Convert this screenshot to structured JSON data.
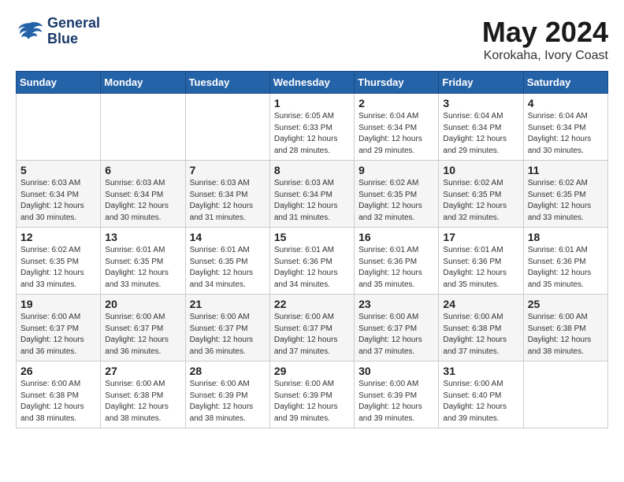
{
  "logo": {
    "line1": "General",
    "line2": "Blue"
  },
  "title": "May 2024",
  "location": "Korokaha, Ivory Coast",
  "weekdays": [
    "Sunday",
    "Monday",
    "Tuesday",
    "Wednesday",
    "Thursday",
    "Friday",
    "Saturday"
  ],
  "weeks": [
    [
      {
        "day": "",
        "info": ""
      },
      {
        "day": "",
        "info": ""
      },
      {
        "day": "",
        "info": ""
      },
      {
        "day": "1",
        "info": "Sunrise: 6:05 AM\nSunset: 6:33 PM\nDaylight: 12 hours\nand 28 minutes."
      },
      {
        "day": "2",
        "info": "Sunrise: 6:04 AM\nSunset: 6:34 PM\nDaylight: 12 hours\nand 29 minutes."
      },
      {
        "day": "3",
        "info": "Sunrise: 6:04 AM\nSunset: 6:34 PM\nDaylight: 12 hours\nand 29 minutes."
      },
      {
        "day": "4",
        "info": "Sunrise: 6:04 AM\nSunset: 6:34 PM\nDaylight: 12 hours\nand 30 minutes."
      }
    ],
    [
      {
        "day": "5",
        "info": "Sunrise: 6:03 AM\nSunset: 6:34 PM\nDaylight: 12 hours\nand 30 minutes."
      },
      {
        "day": "6",
        "info": "Sunrise: 6:03 AM\nSunset: 6:34 PM\nDaylight: 12 hours\nand 30 minutes."
      },
      {
        "day": "7",
        "info": "Sunrise: 6:03 AM\nSunset: 6:34 PM\nDaylight: 12 hours\nand 31 minutes."
      },
      {
        "day": "8",
        "info": "Sunrise: 6:03 AM\nSunset: 6:34 PM\nDaylight: 12 hours\nand 31 minutes."
      },
      {
        "day": "9",
        "info": "Sunrise: 6:02 AM\nSunset: 6:35 PM\nDaylight: 12 hours\nand 32 minutes."
      },
      {
        "day": "10",
        "info": "Sunrise: 6:02 AM\nSunset: 6:35 PM\nDaylight: 12 hours\nand 32 minutes."
      },
      {
        "day": "11",
        "info": "Sunrise: 6:02 AM\nSunset: 6:35 PM\nDaylight: 12 hours\nand 33 minutes."
      }
    ],
    [
      {
        "day": "12",
        "info": "Sunrise: 6:02 AM\nSunset: 6:35 PM\nDaylight: 12 hours\nand 33 minutes."
      },
      {
        "day": "13",
        "info": "Sunrise: 6:01 AM\nSunset: 6:35 PM\nDaylight: 12 hours\nand 33 minutes."
      },
      {
        "day": "14",
        "info": "Sunrise: 6:01 AM\nSunset: 6:35 PM\nDaylight: 12 hours\nand 34 minutes."
      },
      {
        "day": "15",
        "info": "Sunrise: 6:01 AM\nSunset: 6:36 PM\nDaylight: 12 hours\nand 34 minutes."
      },
      {
        "day": "16",
        "info": "Sunrise: 6:01 AM\nSunset: 6:36 PM\nDaylight: 12 hours\nand 35 minutes."
      },
      {
        "day": "17",
        "info": "Sunrise: 6:01 AM\nSunset: 6:36 PM\nDaylight: 12 hours\nand 35 minutes."
      },
      {
        "day": "18",
        "info": "Sunrise: 6:01 AM\nSunset: 6:36 PM\nDaylight: 12 hours\nand 35 minutes."
      }
    ],
    [
      {
        "day": "19",
        "info": "Sunrise: 6:00 AM\nSunset: 6:37 PM\nDaylight: 12 hours\nand 36 minutes."
      },
      {
        "day": "20",
        "info": "Sunrise: 6:00 AM\nSunset: 6:37 PM\nDaylight: 12 hours\nand 36 minutes."
      },
      {
        "day": "21",
        "info": "Sunrise: 6:00 AM\nSunset: 6:37 PM\nDaylight: 12 hours\nand 36 minutes."
      },
      {
        "day": "22",
        "info": "Sunrise: 6:00 AM\nSunset: 6:37 PM\nDaylight: 12 hours\nand 37 minutes."
      },
      {
        "day": "23",
        "info": "Sunrise: 6:00 AM\nSunset: 6:37 PM\nDaylight: 12 hours\nand 37 minutes."
      },
      {
        "day": "24",
        "info": "Sunrise: 6:00 AM\nSunset: 6:38 PM\nDaylight: 12 hours\nand 37 minutes."
      },
      {
        "day": "25",
        "info": "Sunrise: 6:00 AM\nSunset: 6:38 PM\nDaylight: 12 hours\nand 38 minutes."
      }
    ],
    [
      {
        "day": "26",
        "info": "Sunrise: 6:00 AM\nSunset: 6:38 PM\nDaylight: 12 hours\nand 38 minutes."
      },
      {
        "day": "27",
        "info": "Sunrise: 6:00 AM\nSunset: 6:38 PM\nDaylight: 12 hours\nand 38 minutes."
      },
      {
        "day": "28",
        "info": "Sunrise: 6:00 AM\nSunset: 6:39 PM\nDaylight: 12 hours\nand 38 minutes."
      },
      {
        "day": "29",
        "info": "Sunrise: 6:00 AM\nSunset: 6:39 PM\nDaylight: 12 hours\nand 39 minutes."
      },
      {
        "day": "30",
        "info": "Sunrise: 6:00 AM\nSunset: 6:39 PM\nDaylight: 12 hours\nand 39 minutes."
      },
      {
        "day": "31",
        "info": "Sunrise: 6:00 AM\nSunset: 6:40 PM\nDaylight: 12 hours\nand 39 minutes."
      },
      {
        "day": "",
        "info": ""
      }
    ]
  ]
}
